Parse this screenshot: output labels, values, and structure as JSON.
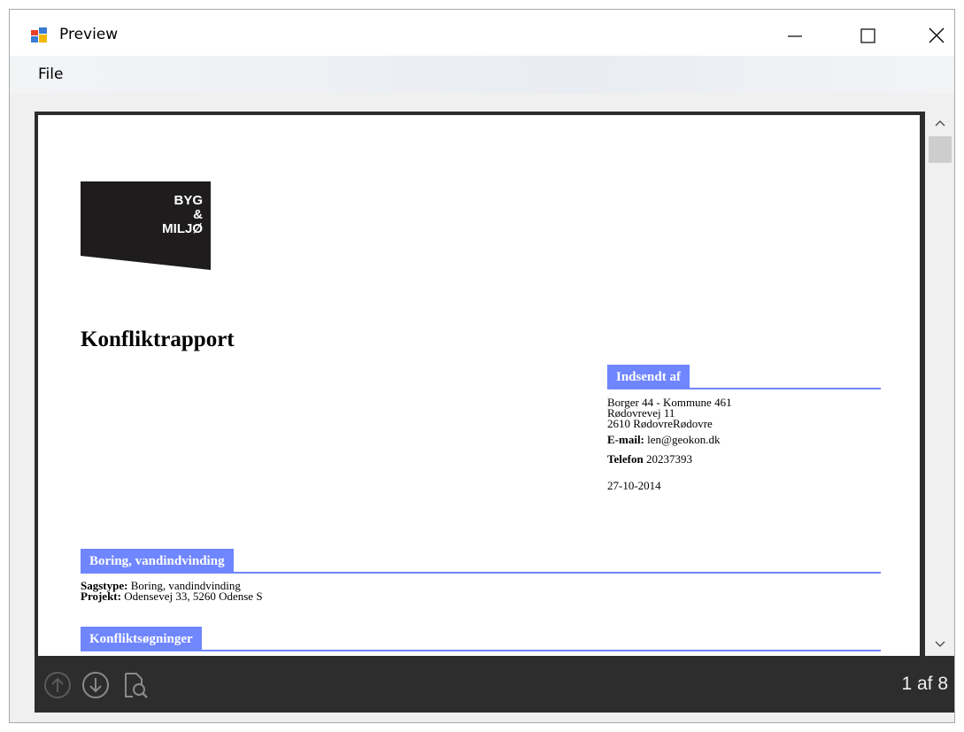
{
  "window": {
    "title": "Preview",
    "controls": {
      "minimize": "minimize-icon",
      "maximize": "maximize-icon",
      "close": "close-icon"
    }
  },
  "menu": {
    "file": "File"
  },
  "document": {
    "logo": {
      "line1": "BYG",
      "line2": "&",
      "line3": "MILJØ"
    },
    "title": "Konfliktrapport",
    "sender_section": {
      "header": "Indsendt af",
      "address_line1": "Borger 44 - Kommune 461",
      "address_line2": "Rødovrevej 11",
      "address_line3": "2610 RødovreRødovre",
      "email_label": "E-mail:",
      "email_value": "len@geokon.dk",
      "phone_label": "Telefon",
      "phone_value": "20237393",
      "date": "27-10-2014"
    },
    "case_section": {
      "header": "Boring, vandindvinding",
      "sagstype_label": "Sagstype:",
      "sagstype_value": "Boring, vandindvinding",
      "projekt_label": "Projekt:",
      "projekt_value": "Odensevej 33, 5260 Odense S"
    },
    "conflicts_section": {
      "header": "Konfliktsøgninger"
    }
  },
  "toolbar": {
    "prev_page_icon": "arrow-up-circle-icon",
    "next_page_icon": "arrow-down-circle-icon",
    "find_icon": "document-search-icon",
    "page_counter": "1 af 8"
  },
  "colors": {
    "section_header": "#6f86ff",
    "viewer_background": "#2d2d2d",
    "toolbar_text": "#f0f0f0",
    "disabled_icon": "#5a5a5a",
    "enabled_icon": "#8a8a8a"
  },
  "scroll": {
    "position_fraction": 0.0
  }
}
